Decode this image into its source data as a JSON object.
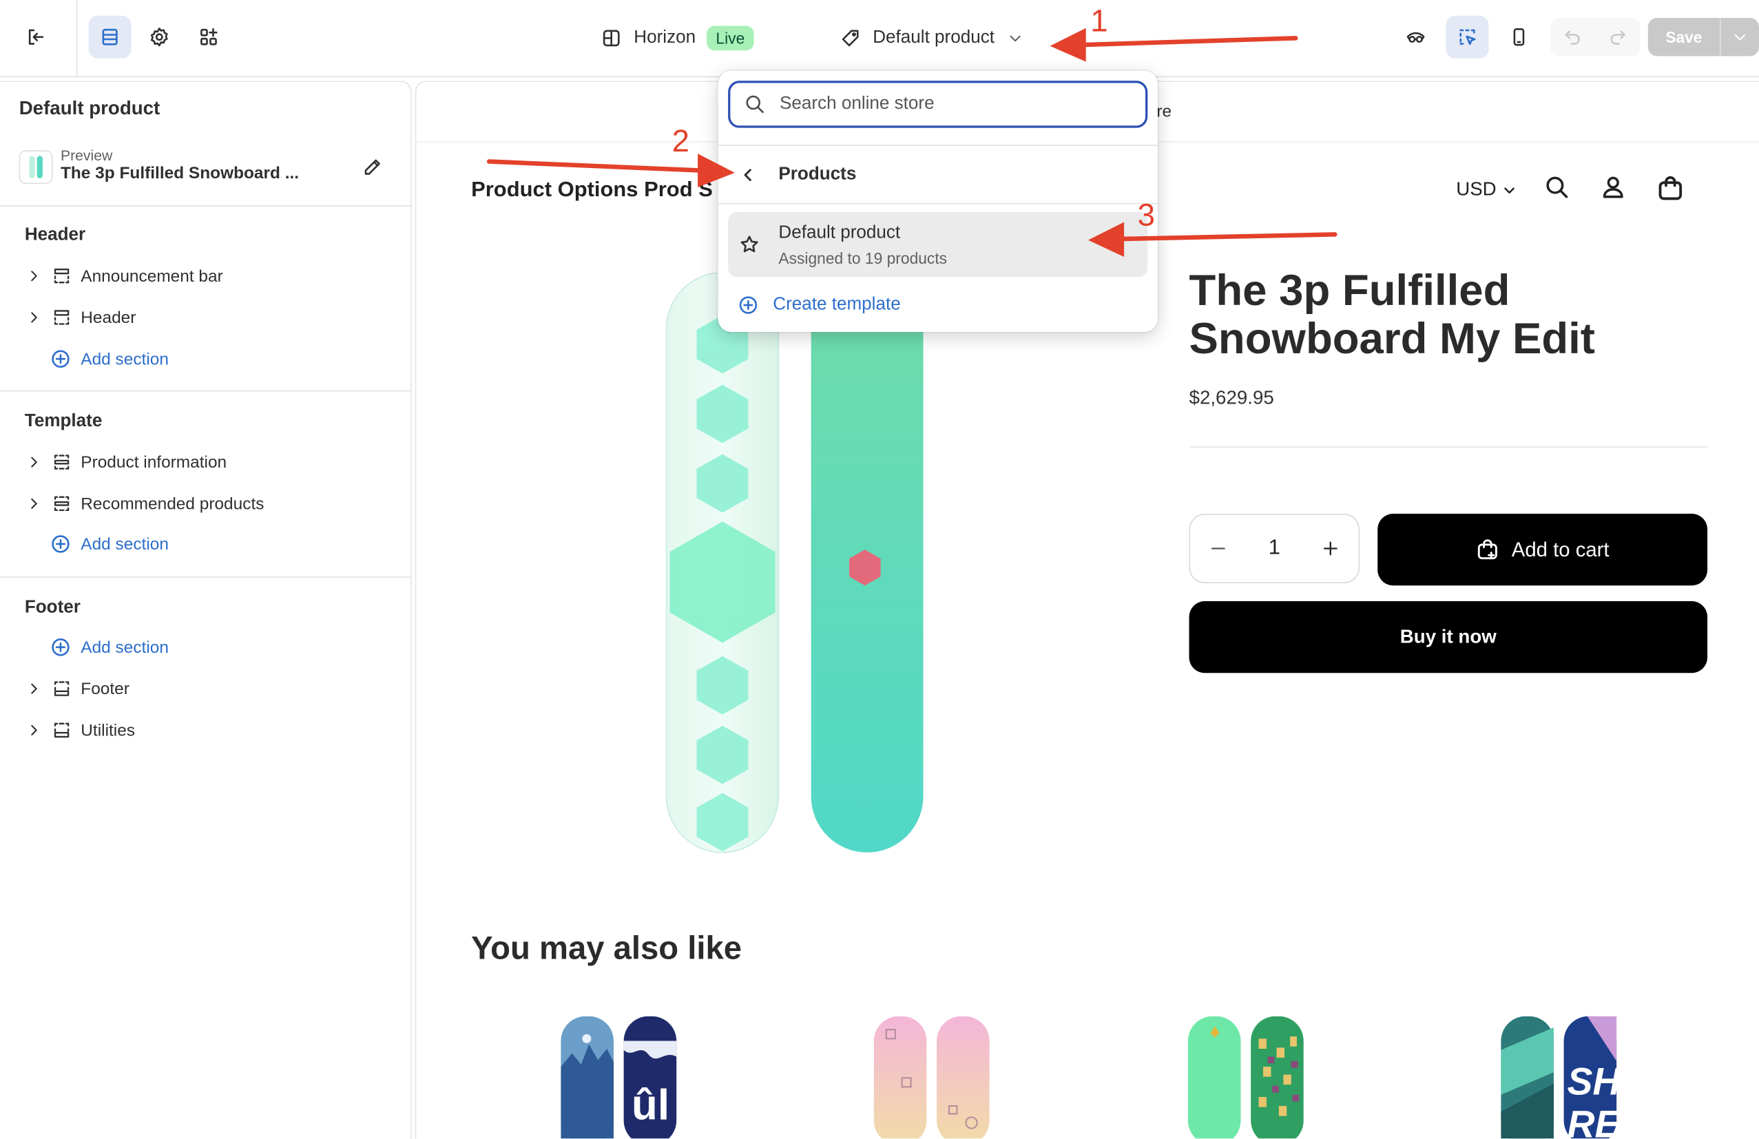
{
  "topbar": {
    "theme_name": "Horizon",
    "theme_status": "Live",
    "template_name": "Default product",
    "save_label": "Save",
    "icons": [
      "exit-icon",
      "sections-icon",
      "settings-icon",
      "apps-icon",
      "inspector-icon",
      "selector-icon",
      "mobile-icon",
      "undo-icon",
      "redo-icon"
    ]
  },
  "sidebar": {
    "title": "Default product",
    "preview_label": "Preview",
    "preview_value": "The 3p Fulfilled Snowboard ...",
    "groups": [
      {
        "title": "Header",
        "items": [
          "Announcement bar",
          "Header"
        ],
        "add_label": "Add section"
      },
      {
        "title": "Template",
        "items": [
          "Product information",
          "Recommended products"
        ],
        "add_label": "Add section"
      },
      {
        "title": "Footer",
        "add_label": "Add section",
        "items": [
          "Footer",
          "Utilities"
        ]
      }
    ]
  },
  "popover": {
    "search_placeholder": "Search online store",
    "back_label": "Products",
    "item_name": "Default product",
    "item_sub": "Assigned to 19 products",
    "create_label": "Create template"
  },
  "storefront": {
    "announcement": "re",
    "store_name": "Product Options Prod S",
    "currency": "USD",
    "product_title": "The 3p Fulfilled Snowboard My Edit",
    "price": "$2,629.95",
    "quantity": "1",
    "add_to_cart": "Add to cart",
    "buy_now": "Buy it now",
    "recommendations_title": "You may also like"
  },
  "annotations": [
    "1",
    "2",
    "3"
  ],
  "colors": {
    "accent": "#2c6ecb",
    "live_badge": "#a8f0b8",
    "annotation": "#e3412b",
    "primary_button": "#000000"
  }
}
